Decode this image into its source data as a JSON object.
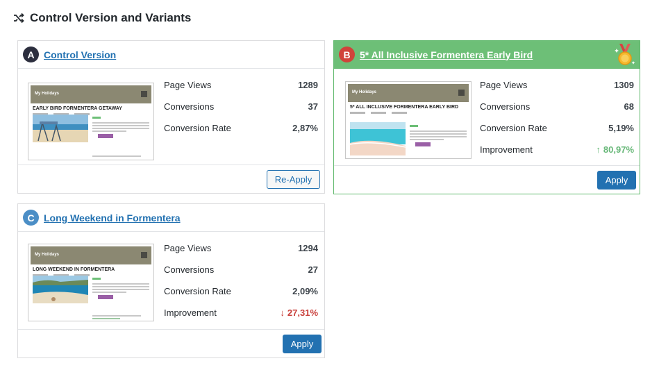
{
  "header": {
    "title": "Control Version and Variants",
    "icon": "shuffle-icon"
  },
  "variants": [
    {
      "letter": "A",
      "name": "Control Version",
      "thumbnail": {
        "site": "My Holidays",
        "title": "EARLY BIRD FORMENTERA GETAWAY"
      },
      "stats": {
        "page_views_label": "Page Views",
        "page_views": "1289",
        "conversions_label": "Conversions",
        "conversions": "37",
        "conversion_rate_label": "Conversion Rate",
        "conversion_rate": "2,87%"
      },
      "button_label": "Re-Apply"
    },
    {
      "letter": "B",
      "name": "5* All Inclusive Formentera Early Bird",
      "winner": true,
      "thumbnail": {
        "site": "My Holidays",
        "title": "5* ALL INCLUSIVE FORMENTERA EARLY BIRD"
      },
      "stats": {
        "page_views_label": "Page Views",
        "page_views": "1309",
        "conversions_label": "Conversions",
        "conversions": "68",
        "conversion_rate_label": "Conversion Rate",
        "conversion_rate": "5,19%",
        "improvement_label": "Improvement",
        "improvement": "80,97%",
        "improvement_arrow": "↑"
      },
      "button_label": "Apply"
    },
    {
      "letter": "C",
      "name": "Long Weekend in Formentera",
      "thumbnail": {
        "site": "My Holidays",
        "title": "LONG WEEKEND IN FORMENTERA"
      },
      "stats": {
        "page_views_label": "Page Views",
        "page_views": "1294",
        "conversions_label": "Conversions",
        "conversions": "27",
        "conversion_rate_label": "Conversion Rate",
        "conversion_rate": "2,09%",
        "improvement_label": "Improvement",
        "improvement": "27,31%",
        "improvement_arrow": "↓"
      },
      "button_label": "Apply"
    }
  ],
  "colors": {
    "winner": "#6dbf77",
    "link": "#2271b1",
    "positive": "#68b879",
    "negative": "#c9403c",
    "primary_button": "#2271b1"
  }
}
